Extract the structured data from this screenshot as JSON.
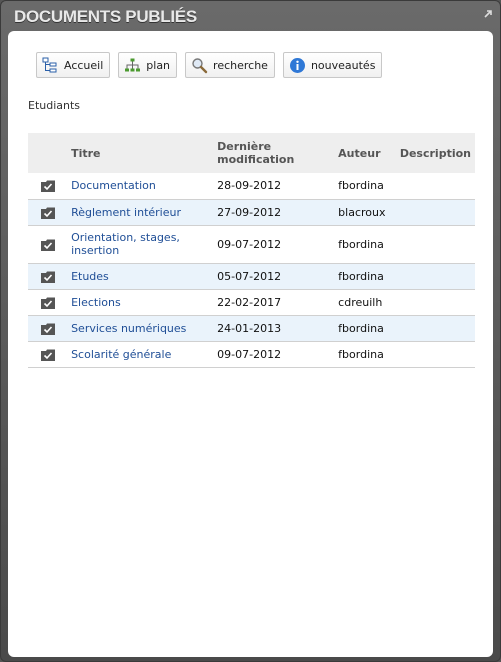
{
  "portlet": {
    "title": "DOCUMENTS PUBLIÉS"
  },
  "nav": {
    "home_label": "Accueil",
    "plan_label": "plan",
    "search_label": "recherche",
    "news_label": "nouveautés"
  },
  "section": {
    "label": "Etudiants"
  },
  "table": {
    "headers": {
      "title": "Titre",
      "modified": "Dernière modification",
      "author": "Auteur",
      "description": "Description"
    },
    "rows": [
      {
        "title": "Documentation",
        "modified": "28-09-2012",
        "author": "fbordina",
        "description": ""
      },
      {
        "title": "Règlement intérieur",
        "modified": "27-09-2012",
        "author": "blacroux",
        "description": ""
      },
      {
        "title": "Orientation, stages, insertion",
        "modified": "09-07-2012",
        "author": "fbordina",
        "description": ""
      },
      {
        "title": "Etudes",
        "modified": "05-07-2012",
        "author": "fbordina",
        "description": ""
      },
      {
        "title": "Elections",
        "modified": "22-02-2017",
        "author": "cdreuilh",
        "description": ""
      },
      {
        "title": "Services numériques",
        "modified": "24-01-2013",
        "author": "fbordina",
        "description": ""
      },
      {
        "title": "Scolarité générale",
        "modified": "09-07-2012",
        "author": "fbordina",
        "description": ""
      }
    ]
  },
  "colors": {
    "link": "#1f4e96",
    "row_alt": "#eaf3fb",
    "header_bg": "#eeeeee",
    "portlet_bg": "#555555"
  }
}
